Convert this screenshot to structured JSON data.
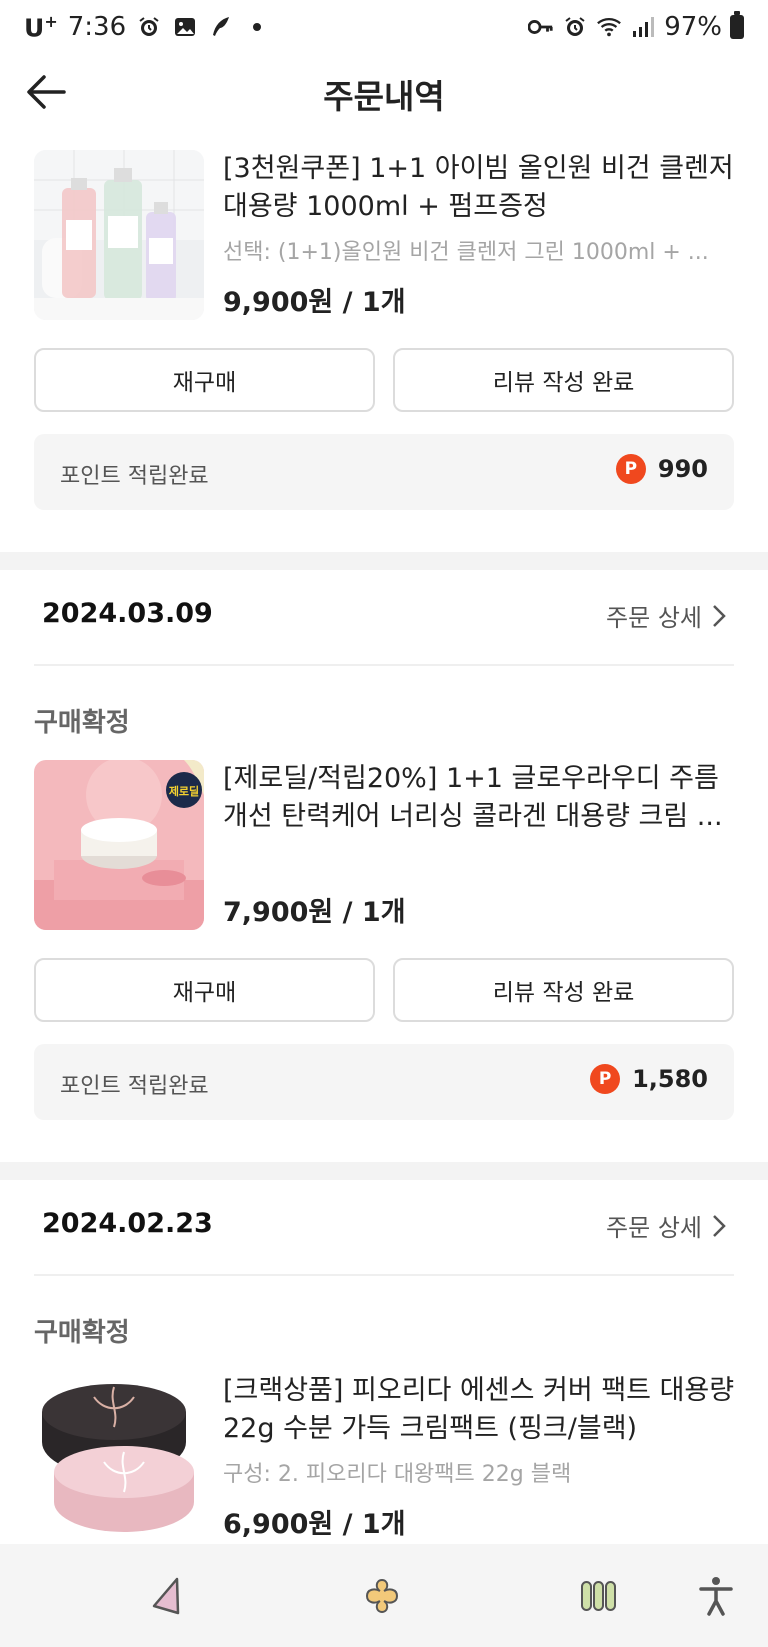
{
  "status_bar": {
    "carrier": "U",
    "carrier_sup": "+",
    "time": "7:36",
    "battery": "97%",
    "left_icons": [
      "alarm-icon",
      "gallery-icon",
      "feather-icon",
      "dot-icon"
    ],
    "right_icons": [
      "key-icon",
      "alarm-icon",
      "wifi-icon",
      "signal-icon",
      "battery-icon"
    ]
  },
  "header": {
    "title": "주문내역",
    "back_icon": "back-arrow-icon"
  },
  "orders": [
    {
      "product": {
        "name": "[3천원쿠폰] 1+1 아이빔 올인원 비건 클렌저 대용량 1000ml + 펌프증정",
        "option": "선택: (1+1)올인원 비건 클렌저 그린 1000ml + ...",
        "price": "9,900원 / 1개"
      },
      "buttons": {
        "rebuy": "재구매",
        "review": "리뷰 작성 완료"
      },
      "points": {
        "label": "포인트 적립완료",
        "badge": "P",
        "value": "990"
      }
    },
    {
      "date": "2024.03.09",
      "detail_link": "주문 상세",
      "status": "구매확정",
      "product": {
        "name": "[제로딜/적립20%] 1+1 글로우라우디 주름개선 탄력케어 너리싱 콜라겐 대용량 크림 ...",
        "price": "7,900원 / 1개",
        "thumb_badge": "제로딜"
      },
      "buttons": {
        "rebuy": "재구매",
        "review": "리뷰 작성 완료"
      },
      "points": {
        "label": "포인트 적립완료",
        "badge": "P",
        "value": "1,580"
      }
    },
    {
      "date": "2024.02.23",
      "detail_link": "주문 상세",
      "status": "구매확정",
      "product": {
        "name": "[크랙상품] 피오리다 에센스 커버 팩트 대용량 22g 수분 가득 크림팩트 (핑크/블랙)",
        "option": "구성: 2. 피오리다 대왕팩트 22g 블랙",
        "price": "6,900원 / 1개"
      }
    }
  ],
  "bottom_nav": [
    "back-triangle-icon",
    "home-clover-icon",
    "recents-icon",
    "accessibility-icon"
  ],
  "colors": {
    "point_badge": "#f0481e",
    "nav_bg": "#f5f5f5",
    "divider": "#f3f3f3"
  }
}
